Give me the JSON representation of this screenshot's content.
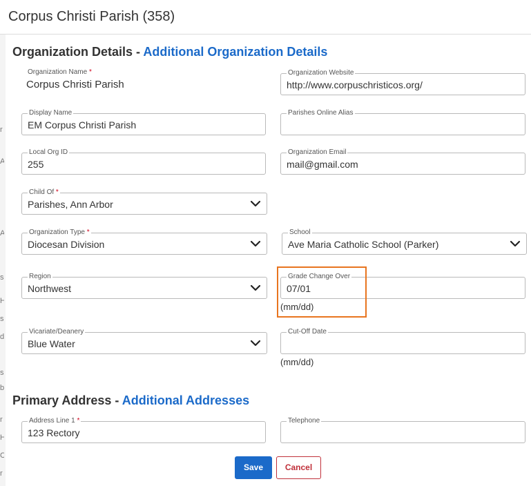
{
  "modal": {
    "title": "Corpus Christi Parish (358)"
  },
  "section_org": {
    "title": "Organization Details - ",
    "link": "Additional Organization Details"
  },
  "fields": {
    "org_name": {
      "label": "Organization Name",
      "required": "*",
      "value": "Corpus Christi Parish"
    },
    "org_website": {
      "label": "Organization Website",
      "value": "http://www.corpuschristicos.org/"
    },
    "display_name": {
      "label": "Display Name",
      "value": "EM Corpus Christi Parish"
    },
    "parishes_alias": {
      "label": "Parishes Online Alias",
      "value": ""
    },
    "local_org_id": {
      "label": "Local Org ID",
      "value": "255"
    },
    "org_email": {
      "label": "Organization Email",
      "value": "mail@gmail.com"
    },
    "child_of": {
      "label": "Child Of",
      "required": "*",
      "value": "Parishes, Ann Arbor"
    },
    "org_type": {
      "label": "Organization Type",
      "required": "*",
      "value": "Diocesan Division"
    },
    "school": {
      "label": "School",
      "value": "Ave Maria Catholic School (Parker)"
    },
    "region": {
      "label": "Region",
      "value": "Northwest"
    },
    "grade_change": {
      "label": "Grade Change Over",
      "value": "07/01",
      "hint": "(mm/dd)"
    },
    "vicariate": {
      "label": "Vicariate/Deanery",
      "value": "Blue Water"
    },
    "cutoff": {
      "label": "Cut-Off Date",
      "value": "",
      "hint": "(mm/dd)"
    },
    "address1": {
      "label": "Address Line 1",
      "required": "*",
      "value": "123 Rectory"
    },
    "telephone": {
      "label": "Telephone",
      "value": ""
    }
  },
  "section_address": {
    "title": "Primary Address - ",
    "link": "Additional Addresses"
  },
  "buttons": {
    "save": "Save",
    "cancel": "Cancel"
  },
  "backdrop_chars": [
    "r",
    "A",
    "A",
    "s",
    "H",
    "s",
    "d",
    "s",
    "b",
    "r",
    "H",
    "C",
    "r"
  ],
  "colors": {
    "accent": "#1b6ac9",
    "danger": "#c0303a",
    "highlight": "#e8741e",
    "required": "#d0021b"
  },
  "icons": {
    "select": "chevron-down-icon"
  }
}
